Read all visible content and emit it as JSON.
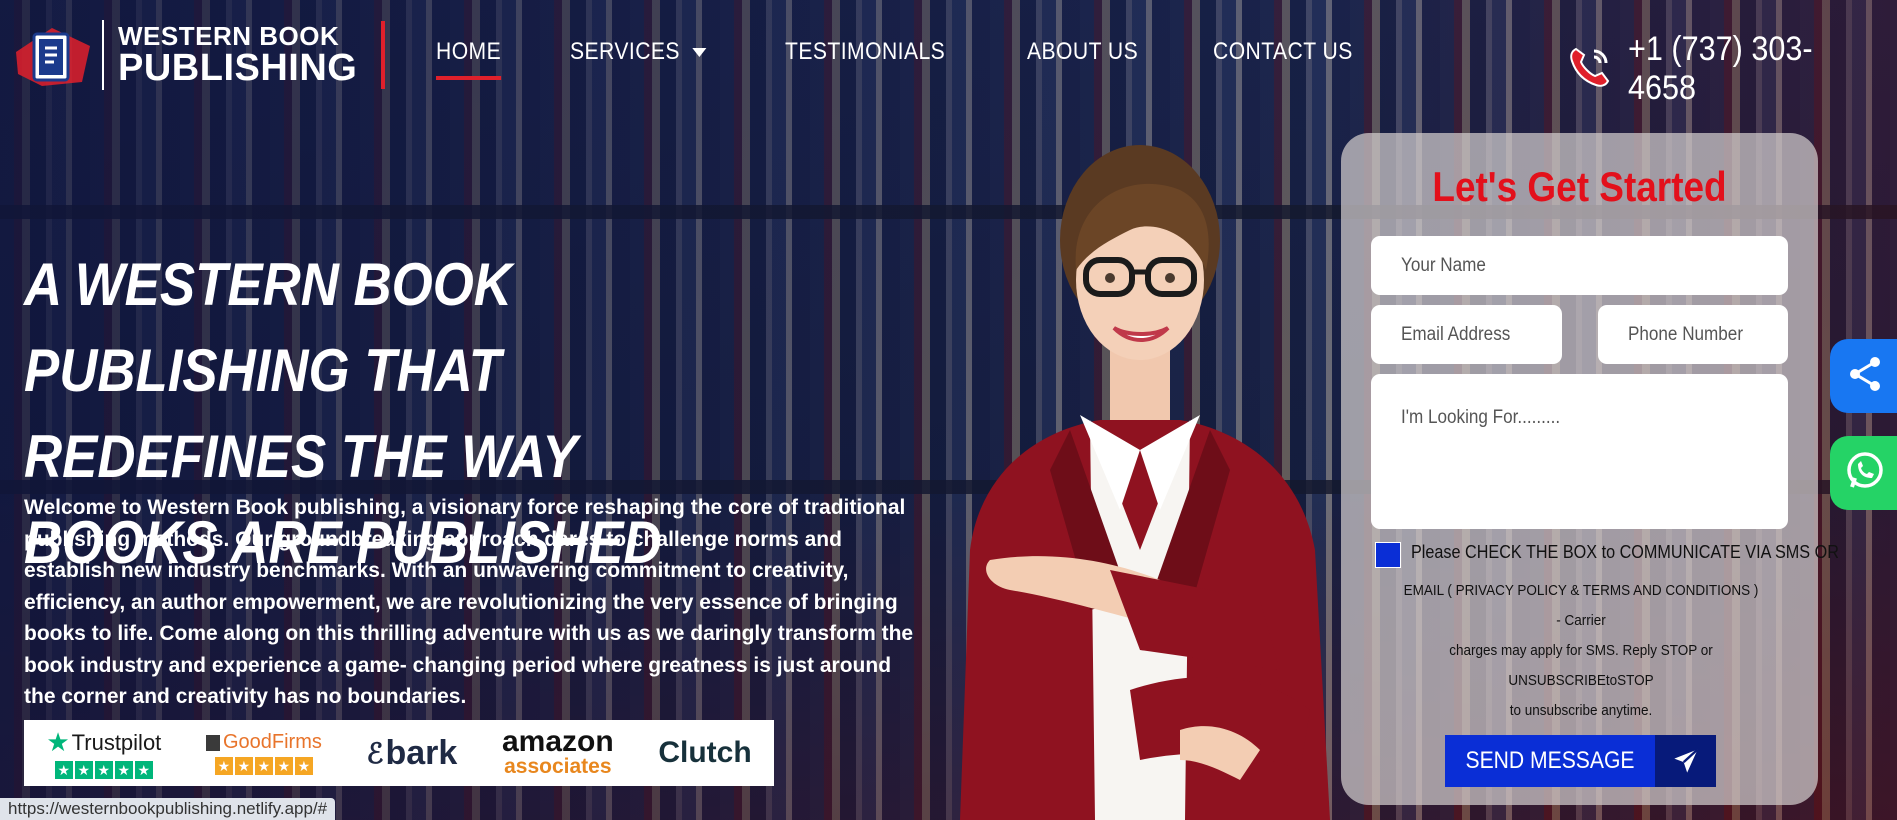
{
  "brand": {
    "line1": "WESTERN BOOK",
    "line2": "PUBLISHING"
  },
  "nav": {
    "items": [
      {
        "label": "HOME",
        "active": true
      },
      {
        "label": "SERVICES",
        "has_dropdown": true
      },
      {
        "label": "TESTIMONIALS"
      },
      {
        "label": "ABOUT US"
      },
      {
        "label": "CONTACT US"
      }
    ]
  },
  "contact": {
    "phone": "+1 (737) 303-4658"
  },
  "hero": {
    "headline": "A WESTERN BOOK PUBLISHING THAT REDEFINES THE WAY BOOKS ARE PUBLISHED",
    "intro": "Welcome to Western Book publishing, a visionary force reshaping the core of traditional publishing methods. Our groundbreaking approach dares to challenge norms and establish new industry benchmarks. With an unwavering commitment to creativity, efficiency, an author empowerment, we are revolutionizing the very essence of bringing books to life. Come along on this thrilling adventure with us as we daringly transform the book industry and experience a game- changing period where greatness is just around the corner and creativity has no boundaries."
  },
  "badges": {
    "trustpilot": "Trustpilot",
    "goodfirms": "GoodFirms",
    "bark": "bark",
    "amazon_l1": "amazon",
    "amazon_l2": "associates",
    "clutch": "Clutch"
  },
  "form": {
    "title": "Let's Get Started",
    "name_placeholder": "Your Name",
    "email_placeholder": "Email Address",
    "phone_placeholder": "Phone Number",
    "message_placeholder": "I'm Looking For.........",
    "consent_line1": "Please CHECK THE BOX to COMMUNICATE VIA SMS OR",
    "consent_line2": "EMAIL ( PRIVACY POLICY & TERMS AND CONDITIONS ) - Carrier",
    "consent_line3": "charges may apply for SMS. Reply STOP or UNSUBSCRIBEtoSTOP",
    "consent_line4": "to unsubscribe anytime.",
    "submit_label": "SEND MESSAGE"
  },
  "status_bar": {
    "url": "https://westernbookpublishing.netlify.app/#"
  },
  "colors": {
    "accent_red": "#e0202b",
    "button_blue": "#0a2ed6",
    "share_blue": "#1877f2",
    "whatsapp_green": "#25d366"
  },
  "icons": [
    "logo-book-icon",
    "caret-down-icon",
    "phone-icon",
    "send-plane-icon",
    "share-icon",
    "whatsapp-icon",
    "trustpilot-star-icon"
  ]
}
